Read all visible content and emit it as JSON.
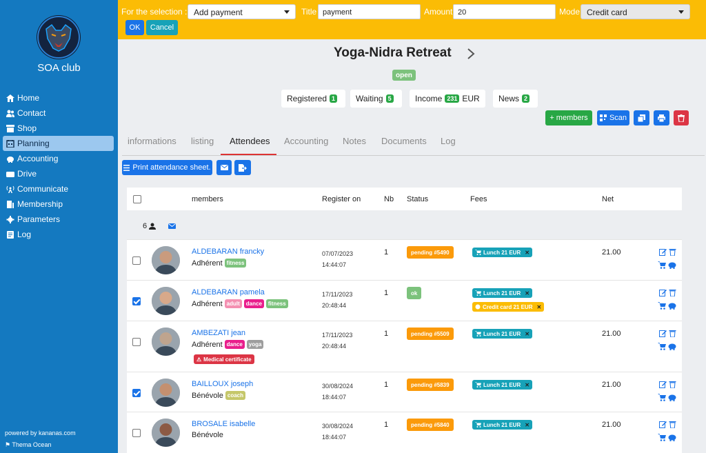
{
  "sidebar": {
    "club_name": "SOA club",
    "items": [
      {
        "label": "Home",
        "icon": "home-icon"
      },
      {
        "label": "Contact",
        "icon": "users-icon"
      },
      {
        "label": "Shop",
        "icon": "shop-icon"
      },
      {
        "label": "Planning",
        "icon": "calendar-icon"
      },
      {
        "label": "Accounting",
        "icon": "piggy-bank-icon"
      },
      {
        "label": "Drive",
        "icon": "drive-icon"
      },
      {
        "label": "Communicate",
        "icon": "broadcast-icon"
      },
      {
        "label": "Membership",
        "icon": "id-card-icon"
      },
      {
        "label": "Parameters",
        "icon": "gear-icon"
      },
      {
        "label": "Log",
        "icon": "log-icon"
      }
    ],
    "powered": "powered by kananas.com",
    "theme": "Thema Ocean"
  },
  "topbar": {
    "selection_label": "For the selection :",
    "action_value": "Add payment",
    "title_label": "Title",
    "title_value": "payment",
    "amount_label": "Amount",
    "amount_value": "20",
    "mode_label": "Mode",
    "mode_value": "Credit card",
    "ok": "OK",
    "cancel": "Cancel"
  },
  "event": {
    "title": "Yoga-Nidra Retreat",
    "status": "open",
    "stats": [
      {
        "label": "Registered",
        "count": "1",
        "suffix": ""
      },
      {
        "label": "Waiting",
        "count": "5",
        "suffix": ""
      },
      {
        "label": "Income",
        "count": "231",
        "suffix": "EUR"
      },
      {
        "label": "News",
        "count": "2",
        "suffix": ""
      }
    ],
    "add_members": "+ members",
    "scan": "Scan"
  },
  "tabs": [
    "informations",
    "listing",
    "Attendees",
    "Accounting",
    "Notes",
    "Documents",
    "Log"
  ],
  "active_tab": "Attendees",
  "print_sheet": "Print attendance sheet.",
  "table": {
    "headers": {
      "members": "members",
      "register": "Register on",
      "nb": "Nb",
      "status": "Status",
      "fees": "Fees",
      "net": "Net"
    },
    "group_count": "6",
    "rows": [
      {
        "name": "ALDEBARAN francky",
        "role": "Adhérent",
        "tags": [
          {
            "t": "fitness",
            "c": "#7cc27c"
          }
        ],
        "date": "07/07/2023",
        "time": "14:44:07",
        "nb": "1",
        "status": "pending #5490",
        "fees": [
          {
            "t": "Lunch 21 EUR",
            "k": "lunch"
          }
        ],
        "net": "21.00",
        "checked": false,
        "medical": ""
      },
      {
        "name": "ALDEBARAN pamela",
        "role": "Adhérent",
        "tags": [
          {
            "t": "adult",
            "c": "#f48fb1"
          },
          {
            "t": "dance",
            "c": "#e91e8c"
          },
          {
            "t": "fitness",
            "c": "#7cc27c"
          }
        ],
        "date": "17/11/2023",
        "time": "20:48:44",
        "nb": "1",
        "status": "ok",
        "fees": [
          {
            "t": "Lunch 21 EUR",
            "k": "lunch"
          },
          {
            "t": "Credit card 21 EUR",
            "k": "card"
          }
        ],
        "net": "",
        "checked": true,
        "medical": ""
      },
      {
        "name": "AMBEZATI jean",
        "role": "Adhérent",
        "tags": [
          {
            "t": "dance",
            "c": "#e91e8c"
          },
          {
            "t": "yoga",
            "c": "#9e9e9e"
          }
        ],
        "date": "17/11/2023",
        "time": "20:48:44",
        "nb": "1",
        "status": "pending #5509",
        "fees": [
          {
            "t": "Lunch 21 EUR",
            "k": "lunch"
          }
        ],
        "net": "21.00",
        "checked": false,
        "medical": "Medical certificate"
      },
      {
        "name": "BAILLOUX joseph",
        "role": "Bénévole",
        "tags": [
          {
            "t": "coach",
            "c": "#c5c76a"
          }
        ],
        "date": "30/08/2024",
        "time": "18:44:07",
        "nb": "1",
        "status": "pending #5839",
        "fees": [
          {
            "t": "Lunch 21 EUR",
            "k": "lunch"
          }
        ],
        "net": "21.00",
        "checked": true,
        "medical": ""
      },
      {
        "name": "BROSALE isabelle",
        "role": "Bénévole",
        "tags": [],
        "date": "30/08/2024",
        "time": "18:44:07",
        "nb": "1",
        "status": "pending #5840",
        "fees": [
          {
            "t": "Lunch 21 EUR",
            "k": "lunch"
          }
        ],
        "net": "21.00",
        "checked": false,
        "medical": ""
      }
    ]
  },
  "colors": {
    "sidebar": "#1479c0",
    "topbar": "#fbbc05",
    "pending": "#fb9a0a",
    "ok": "#7cc27c",
    "fee": "#17a2b8",
    "primary": "#1a73e8",
    "success": "#28a745",
    "danger": "#dc3545"
  }
}
